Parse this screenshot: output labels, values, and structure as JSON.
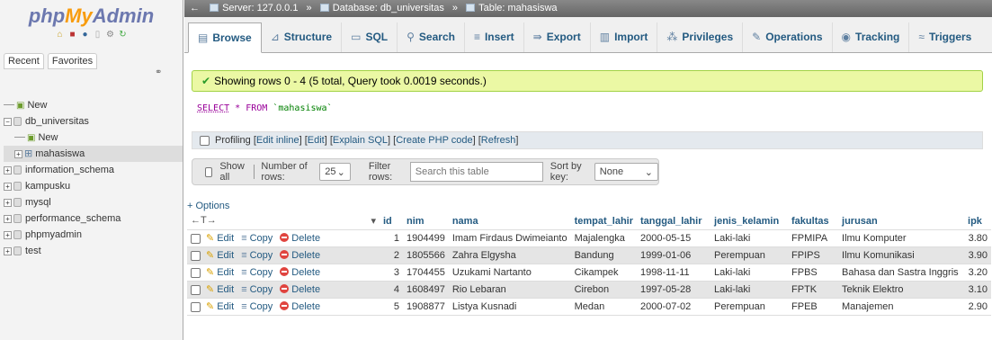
{
  "nav": {
    "logo": {
      "php": "php",
      "my": "My",
      "admin": "Admin"
    },
    "tabs": [
      "Recent",
      "Favorites"
    ],
    "new_label": "New",
    "tree": [
      {
        "label": "db_universitas",
        "expanded": true
      },
      {
        "label": "New",
        "child": true
      },
      {
        "label": "mahasiswa",
        "child": true,
        "selected": true
      },
      {
        "label": "information_schema"
      },
      {
        "label": "kampusku"
      },
      {
        "label": "mysql"
      },
      {
        "label": "performance_schema"
      },
      {
        "label": "phpmyadmin"
      },
      {
        "label": "test"
      }
    ]
  },
  "breadcrumb": {
    "server": "Server: 127.0.0.1",
    "database": "Database: db_universitas",
    "table": "Table: mahasiswa"
  },
  "tabs": [
    "Browse",
    "Structure",
    "SQL",
    "Search",
    "Insert",
    "Export",
    "Import",
    "Privileges",
    "Operations",
    "Tracking",
    "Triggers"
  ],
  "success_message": "Showing rows 0 - 4 (5 total, Query took 0.0019 seconds.)",
  "sql": {
    "select": "SELECT",
    "star": "*",
    "from": "FROM",
    "table": "`mahasiswa`"
  },
  "profiling": {
    "label": "Profiling",
    "links": [
      "Edit inline",
      "Edit",
      "Explain SQL",
      "Create PHP code",
      "Refresh"
    ]
  },
  "nav_bar": {
    "show_all": "Show all",
    "rows_label": "Number of rows:",
    "rows_value": "25",
    "filter_label": "Filter rows:",
    "filter_placeholder": "Search this table",
    "sort_label": "Sort by key:",
    "sort_value": "None"
  },
  "options_label": "+ Options",
  "table": {
    "columns": [
      "id",
      "nim",
      "nama",
      "tempat_lahir",
      "tanggal_lahir",
      "jenis_kelamin",
      "fakultas",
      "jurusan",
      "ipk"
    ],
    "actions": {
      "edit": "Edit",
      "copy": "Copy",
      "delete": "Delete"
    },
    "rows": [
      [
        "1",
        "1904499",
        "Imam Firdaus Dwimeianto",
        "Majalengka",
        "2000-05-15",
        "Laki-laki",
        "FPMIPA",
        "Ilmu Komputer",
        "3.80"
      ],
      [
        "2",
        "1805566",
        "Zahra Elgysha",
        "Bandung",
        "1999-01-06",
        "Perempuan",
        "FPIPS",
        "Ilmu Komunikasi",
        "3.90"
      ],
      [
        "3",
        "1704455",
        "Uzukami Nartanto",
        "Cikampek",
        "1998-11-11",
        "Laki-laki",
        "FPBS",
        "Bahasa dan Sastra Inggris",
        "3.20"
      ],
      [
        "4",
        "1608497",
        "Rio Lebaran",
        "Cirebon",
        "1997-05-28",
        "Laki-laki",
        "FPTK",
        "Teknik Elektro",
        "3.10"
      ],
      [
        "5",
        "1908877",
        "Listya Kusnadi",
        "Medan",
        "2000-07-02",
        "Perempuan",
        "FPEB",
        "Manajemen",
        "2.90"
      ]
    ]
  }
}
